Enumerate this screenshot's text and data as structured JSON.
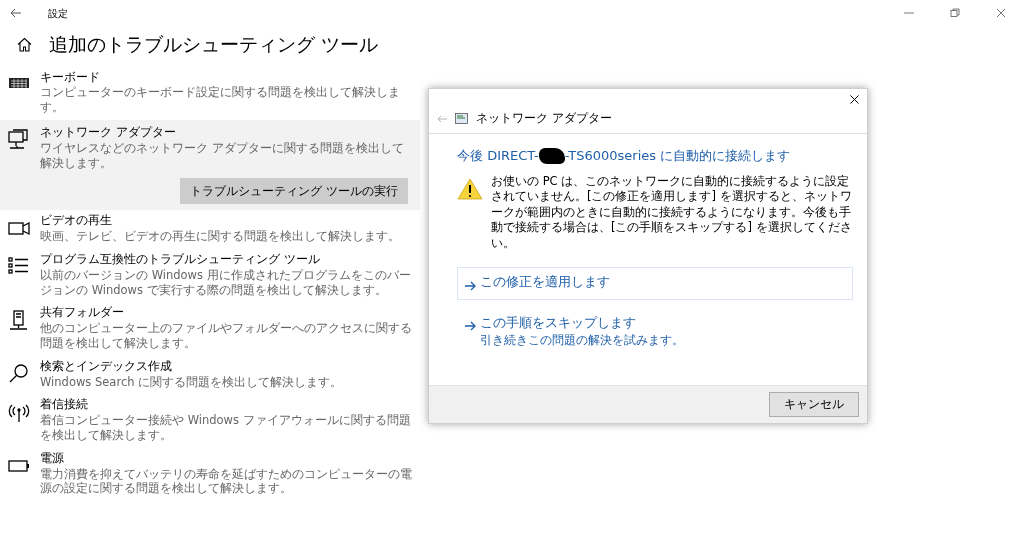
{
  "window": {
    "title": "設定"
  },
  "page": {
    "title": "追加のトラブルシューティング ツール"
  },
  "troubleshooters": [
    {
      "kind": "keyboard",
      "title": "キーボード",
      "description": "コンピューターのキーボード設定に関する問題を検出して解決します。",
      "selected": false
    },
    {
      "kind": "network",
      "title": "ネットワーク アダプター",
      "description": "ワイヤレスなどのネットワーク アダプターに関する問題を検出して解決します。",
      "selected": true,
      "run_button": "トラブルシューティング ツールの実行"
    },
    {
      "kind": "video",
      "title": "ビデオの再生",
      "description": "映画、テレビ、ビデオの再生に関する問題を検出して解決します。",
      "selected": false
    },
    {
      "kind": "list",
      "title": "プログラム互換性のトラブルシューティング ツール",
      "description": "以前のバージョンの Windows 用に作成されたプログラムをこのバージョンの Windows で実行する際の問題を検出して解決します。",
      "selected": false
    },
    {
      "kind": "share",
      "title": "共有フォルダー",
      "description": "他のコンピューター上のファイルやフォルダーへのアクセスに関する問題を検出して解決します。",
      "selected": false
    },
    {
      "kind": "search",
      "title": "検索とインデックス作成",
      "description": "Windows Search に関する問題を検出して解決します。",
      "selected": false
    },
    {
      "kind": "antenna",
      "title": "着信接続",
      "description": "着信コンピューター接続や Windows ファイアウォールに関する問題を検出して解決します。",
      "selected": false
    },
    {
      "kind": "battery",
      "title": "電源",
      "description": "電力消費を抑えてバッテリの寿命を延ばすためのコンピューターの電源の設定に関する問題を検出して解決します。",
      "selected": false
    }
  ],
  "dialog": {
    "title": "ネットワーク アダプター",
    "heading_before": "今後 DIRECT-",
    "redacted": true,
    "heading_after": "-TS6000series に自動的に接続します",
    "warning": "お使いの PC は、このネットワークに自動的に接続するように設定されていません。[この修正を適用します] を選択すると、ネットワークが範囲内のときに自動的に接続するようになります。今後も手動で接続する場合は、[この手順をスキップする] を選択してください。",
    "options": [
      {
        "label": "この修正を適用します",
        "selected": true
      },
      {
        "label": "この手順をスキップします",
        "description": "引き続きこの問題の解決を試みます。",
        "selected": false
      }
    ],
    "cancel_button": "キャンセル"
  }
}
